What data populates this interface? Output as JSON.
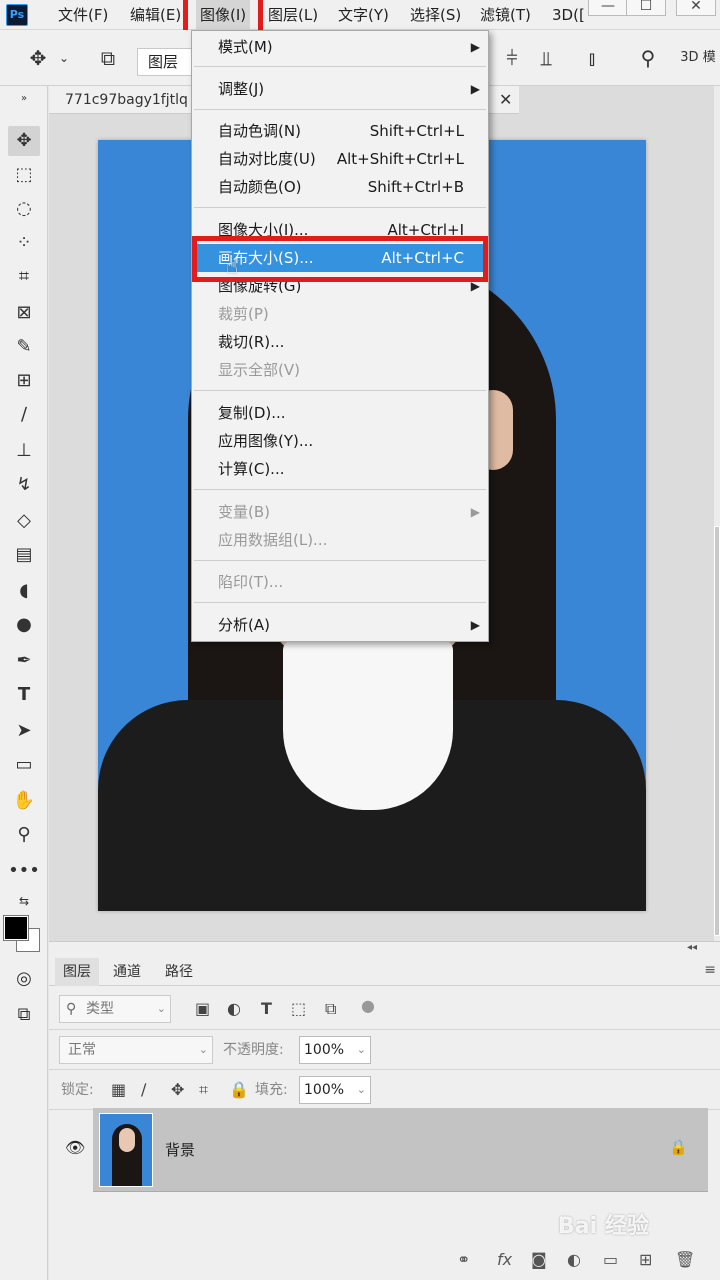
{
  "app": {
    "logo": "Ps"
  },
  "menubar": {
    "items": [
      "文件(F)",
      "编辑(E)",
      "图像(I)",
      "图层(L)",
      "文字(Y)",
      "选择(S)",
      "滤镜(T)",
      "3D(["
    ],
    "active_index": 2,
    "window_buttons": [
      "—",
      "☐",
      "✕"
    ]
  },
  "options_bar": {
    "move_icon": "move-tool-icon",
    "layer_select": "图层",
    "label_3d": "3D 模"
  },
  "document": {
    "tab_title": "771c97bagy1fjtlq",
    "close_glyph": "✕",
    "photo_bg_color": "#3a86d6"
  },
  "image_menu": {
    "items": [
      {
        "label": "模式(M)",
        "shortcut": "",
        "submenu": true,
        "disabled": false
      },
      {
        "label": "调整(J)",
        "shortcut": "",
        "submenu": true,
        "disabled": false
      },
      {
        "label": "自动色调(N)",
        "shortcut": "Shift+Ctrl+L",
        "submenu": false,
        "disabled": false
      },
      {
        "label": "自动对比度(U)",
        "shortcut": "Alt+Shift+Ctrl+L",
        "submenu": false,
        "disabled": false
      },
      {
        "label": "自动颜色(O)",
        "shortcut": "Shift+Ctrl+B",
        "submenu": false,
        "disabled": false
      },
      {
        "label": "图像大小(I)...",
        "shortcut": "Alt+Ctrl+I",
        "submenu": false,
        "disabled": false
      },
      {
        "label": "画布大小(S)...",
        "shortcut": "Alt+Ctrl+C",
        "submenu": false,
        "disabled": false,
        "highlighted": true
      },
      {
        "label": "图像旋转(G)",
        "shortcut": "",
        "submenu": true,
        "disabled": false
      },
      {
        "label": "裁剪(P)",
        "shortcut": "",
        "submenu": false,
        "disabled": true
      },
      {
        "label": "裁切(R)...",
        "shortcut": "",
        "submenu": false,
        "disabled": false
      },
      {
        "label": "显示全部(V)",
        "shortcut": "",
        "submenu": false,
        "disabled": true
      },
      {
        "label": "复制(D)...",
        "shortcut": "",
        "submenu": false,
        "disabled": false
      },
      {
        "label": "应用图像(Y)...",
        "shortcut": "",
        "submenu": false,
        "disabled": false
      },
      {
        "label": "计算(C)...",
        "shortcut": "",
        "submenu": false,
        "disabled": false
      },
      {
        "label": "变量(B)",
        "shortcut": "",
        "submenu": true,
        "disabled": true
      },
      {
        "label": "应用数据组(L)...",
        "shortcut": "",
        "submenu": false,
        "disabled": true
      },
      {
        "label": "陷印(T)...",
        "shortcut": "",
        "submenu": false,
        "disabled": true
      },
      {
        "label": "分析(A)",
        "shortcut": "",
        "submenu": true,
        "disabled": false
      }
    ],
    "highlight_color": "#3592df",
    "annotation_color": "#e21b1b"
  },
  "layers_panel": {
    "tabs": [
      "图层",
      "通道",
      "路径"
    ],
    "active_tab": 0,
    "filter_label": "类型",
    "blend_mode": "正常",
    "opacity_label": "不透明度:",
    "opacity_value": "100%",
    "lock_label": "锁定:",
    "fill_label": "填充:",
    "fill_value": "100%",
    "layers": [
      {
        "name": "背景",
        "visible": true,
        "locked": true
      }
    ]
  },
  "watermark": "Bai 经验"
}
